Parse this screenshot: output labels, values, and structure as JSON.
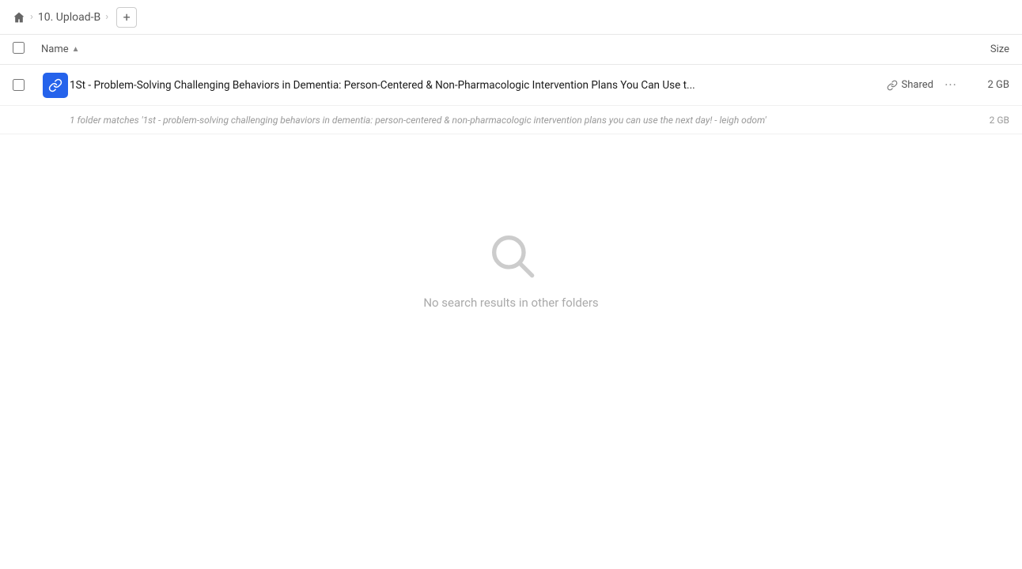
{
  "breadcrumb": {
    "home_label": "Home",
    "separator": "›",
    "folder_name": "10. Upload-B",
    "add_label": "+"
  },
  "table_header": {
    "name_label": "Name",
    "sort_indicator": "▲",
    "size_label": "Size"
  },
  "file_row": {
    "name": "1St - Problem-Solving Challenging Behaviors in Dementia: Person-Centered & Non-Pharmacologic Intervention Plans You Can Use t...",
    "shared_label": "Shared",
    "more_label": "···",
    "size": "2 GB"
  },
  "match_row": {
    "text": "1 folder matches '1st - problem-solving challenging behaviors in dementia: person-centered & non-pharmacologic intervention plans you can use the next day! - leigh odom'",
    "size": "2 GB"
  },
  "empty_state": {
    "message": "No search results in other folders"
  }
}
